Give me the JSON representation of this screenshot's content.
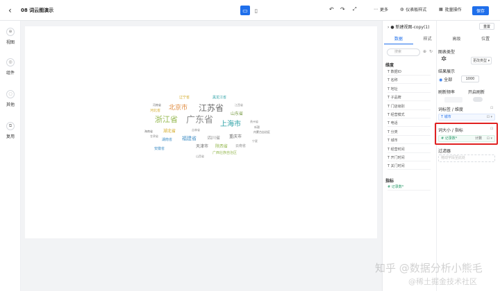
{
  "header": {
    "title": "08 词云图演示",
    "more_label": "更多",
    "dashboard_style_label": "仪表板样式",
    "batch_label": "批量操作",
    "save_label": "保存"
  },
  "leftrail": {
    "items": [
      {
        "label": "视图"
      },
      {
        "label": "组件"
      },
      {
        "label": "其他"
      },
      {
        "label": "复用"
      }
    ]
  },
  "wordcloud": {
    "words": [
      {
        "text": "江苏省",
        "color": "#6b6b6b"
      },
      {
        "text": "广东省",
        "color": "#8c8c8c"
      },
      {
        "text": "浙江省",
        "color": "#95b850"
      },
      {
        "text": "北京市",
        "color": "#e08a3c"
      },
      {
        "text": "上海市",
        "color": "#2aa0a5"
      },
      {
        "text": "山东省",
        "color": "#7a9c46"
      },
      {
        "text": "福建省",
        "color": "#3c8cc4"
      },
      {
        "text": "四川省",
        "color": "#8c8c8c"
      },
      {
        "text": "重庆市",
        "color": "#6b6b6b"
      },
      {
        "text": "湖北省",
        "color": "#d4aa28"
      },
      {
        "text": "天津市",
        "color": "#6b6b6b"
      },
      {
        "text": "陕西省",
        "color": "#95b850"
      },
      {
        "text": "湖南省",
        "color": "#3c8cc4"
      },
      {
        "text": "辽宁省",
        "color": "#d4aa28"
      },
      {
        "text": "河北省",
        "color": "#d4aa28"
      },
      {
        "text": "安徽省",
        "color": "#3c8cc4"
      },
      {
        "text": "云南省",
        "color": "#8c8c8c"
      },
      {
        "text": "黑龙江省",
        "color": "#2aa0a5"
      },
      {
        "text": "广西壮族自治区",
        "color": "#95b850"
      },
      {
        "text": "河南省",
        "color": "#6b6b6b"
      },
      {
        "text": "江西省",
        "color": "#8c8c8c"
      },
      {
        "text": "吉林省",
        "color": "#8c8c8c"
      },
      {
        "text": "内蒙古自治区",
        "color": "#6b6b6b"
      },
      {
        "text": "贵州省",
        "color": "#8c8c8c"
      },
      {
        "text": "海南省",
        "color": "#6b6b6b"
      },
      {
        "text": "甘肃省",
        "color": "#8c8c8c"
      },
      {
        "text": "山西省",
        "color": "#8c8c8c"
      },
      {
        "text": "宁夏",
        "color": "#8c8c8c"
      },
      {
        "text": "新疆",
        "color": "#8c8c8c"
      }
    ]
  },
  "datapanel": {
    "view_name": "新建视图-copy(1)",
    "reset_label": "重置",
    "tabs": [
      "数据",
      "样式",
      "高级",
      "位置"
    ],
    "search_placeholder": "搜索",
    "dimension_title": "维度",
    "dimensions": [
      "数据ID",
      "名称",
      "地址",
      "子品牌",
      "门店级别",
      "经营模式",
      "电话",
      "分类",
      "城市",
      "经营时间",
      "开门时间",
      "关门时间"
    ],
    "measure_title": "指标",
    "measures": [
      "记录数*"
    ]
  },
  "settings": {
    "chart_type_label": "图表类型",
    "change_type_label": "更改类型",
    "result_label": "结果展示",
    "all_label": "全部",
    "limit_value": "1000",
    "refresh_label": "刷新频率",
    "auto_refresh_label": "开启刷新",
    "word_label": "词标签 / 维度",
    "word_field": "城市",
    "size_label": "词大小 / 指标",
    "size_field": "记录数*",
    "size_agg": "计数",
    "filter_label": "过滤器",
    "filter_placeholder": "拖动字段至此处"
  },
  "watermark": {
    "line1": "知乎 @数据分析小熊毛",
    "line2": "@稀土掘金技术社区"
  }
}
